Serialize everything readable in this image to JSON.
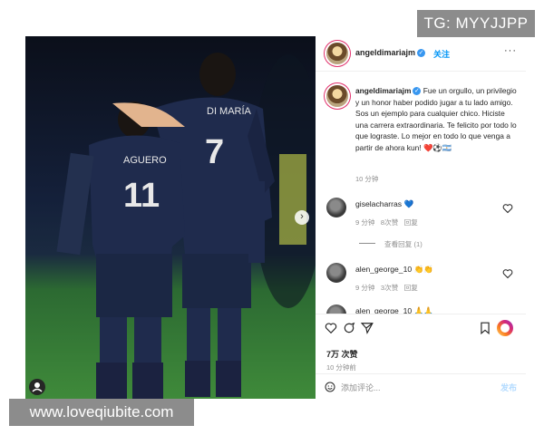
{
  "watermark_top": "TG: MYYJJPP",
  "watermark_bottom": "www.loveqiubite.com",
  "photo": {
    "jersey_left_name": "AGUERO",
    "jersey_left_number": "11",
    "jersey_right_name": "DI MARÍA",
    "jersey_right_number": "7"
  },
  "header": {
    "username": "angeldimariajm",
    "follow_label": "关注",
    "more_label": "···"
  },
  "caption": {
    "username": "angeldimariajm",
    "text": "Fue un orgullo, un privilegio y un honor haber podido jugar a tu lado amigo. Sos un ejemplo para cualquier chico. Hiciste una carrera extraordinaria. Te felicito por todo lo que lograste. Lo mejor en todo lo que venga a partir de ahora kun! ❤️⚽🇦🇷",
    "time": "10 分钟"
  },
  "comments": [
    {
      "username": "giselacharras",
      "emoji": "💙",
      "time": "9 分钟",
      "likes": "8次赞",
      "reply": "回复",
      "view_replies": "查看回复 (1)"
    },
    {
      "username": "alen_george_10",
      "emoji": "👏👏",
      "time": "9 分钟",
      "likes": "3次赞",
      "reply": "回复"
    },
    {
      "username": "alen_george_10",
      "emoji": "🙏🙏"
    }
  ],
  "likes_count": "7万 次赞",
  "post_time": "10 分钟前",
  "add_comment": {
    "placeholder": "添加评论...",
    "post_label": "发布"
  },
  "icons": {
    "like": "heart-icon",
    "comment": "comment-icon",
    "share": "share-icon",
    "save": "bookmark-icon",
    "emoji": "emoji-icon",
    "next": "chevron-right-icon",
    "tag": "user-tag-icon"
  },
  "colors": {
    "accent": "#0095f6",
    "verified": "#3897f0",
    "jersey": "#1f2b4d"
  }
}
